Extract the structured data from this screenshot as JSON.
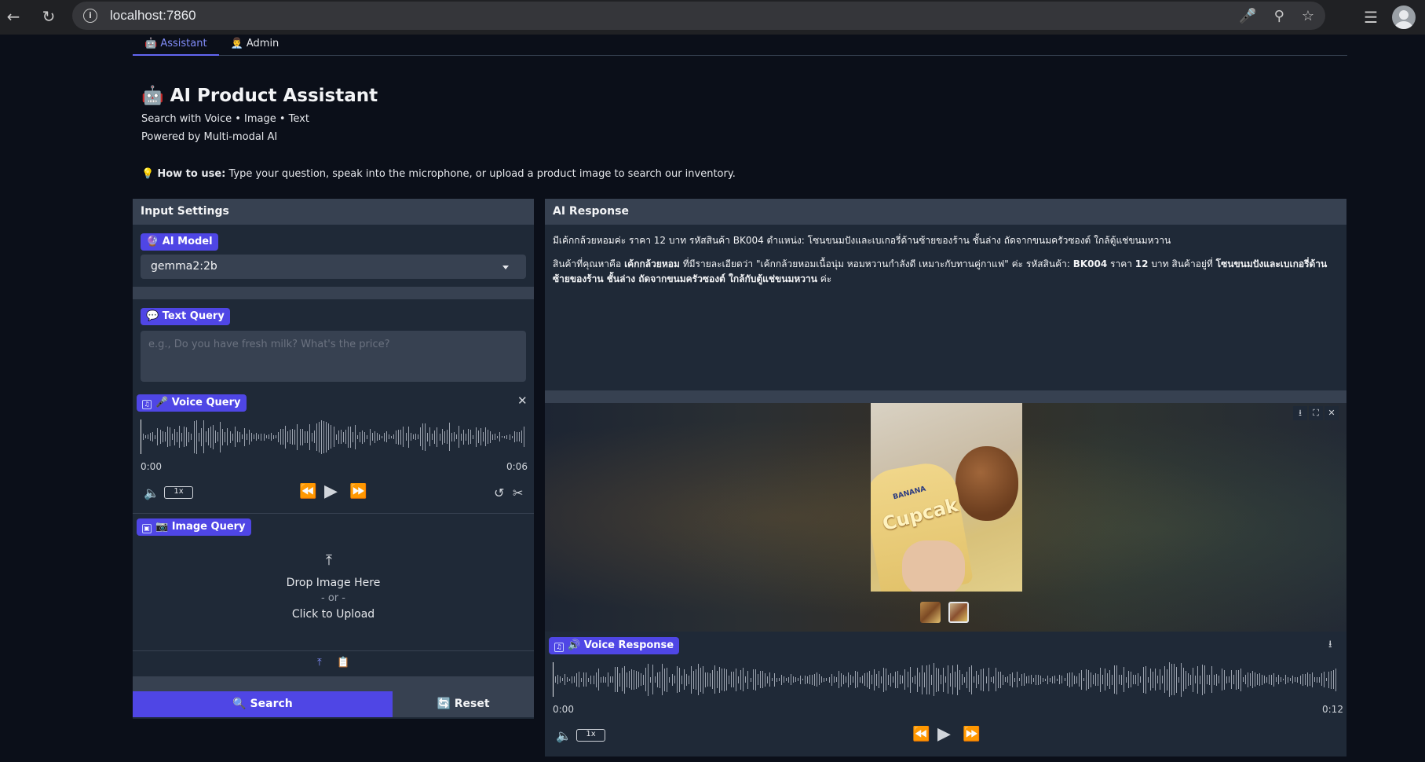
{
  "browser": {
    "url": "localhost:7860"
  },
  "tabs": [
    {
      "label": "🤖 Assistant"
    },
    {
      "label": "👨‍💼 Admin"
    }
  ],
  "header": {
    "title": "🤖 AI Product Assistant",
    "subtitle1": "Search with Voice • Image • Text",
    "subtitle2": "Powered by Multi-modal AI",
    "howto_label": "How to use:",
    "howto_text": " Type your question, speak into the microphone, or upload a product image to search our inventory."
  },
  "input_panel": {
    "title": "Input Settings",
    "model_label": "🔮 AI Model",
    "model_value": "gemma2:2b",
    "text_label": "💬 Text Query",
    "text_placeholder": "e.g., Do you have fresh milk? What's the price?",
    "voice_label": "🎤 Voice Query",
    "voice_time_start": "0:00",
    "voice_time_end": "0:06",
    "voice_speed": "1x",
    "image_label": "📷 Image Query",
    "drop_text": "Drop Image Here",
    "or_text": "- or -",
    "upload_text": "Click to Upload",
    "search_button": "🔍 Search",
    "reset_button": "🔄 Reset"
  },
  "response_panel": {
    "title": "AI Response",
    "line1": "มีเค้กกล้วยหอมค่ะ ราคา 12 บาท รหัสสินค้า BK004 ตำแหน่ง: โซนขนมปังและเบเกอรี่ด้านซ้ายของร้าน ชั้นล่าง ถัดจากขนมครัวซองต์ ใกล้ตู้แช่ขนมหวาน",
    "line2_a": "สินค้าที่คุณหาคือ ",
    "line2_b": "เค้กกล้วยหอม",
    "line2_c": " ที่มีรายละเอียดว่า \"เค้กกล้วยหอมเนื้อนุ่ม หอมหวานกำลังดี เหมาะกับทานคู่กาแฟ\" ค่ะ รหัสสินค้า: ",
    "line2_d": "BK004",
    "line2_e": " ราคา ",
    "line2_f": "12",
    "line2_g": " บาท สินค้าอยู่ที่ ",
    "line2_h": "โซนขนมปังและเบเกอรี่ด้านซ้ายของร้าน ชั้นล่าง ถัดจากขนมครัวซองต์ ใกล้กับตู้แช่ขนมหวาน",
    "line2_i": " ค่ะ",
    "product_text": "Cupcak",
    "product_brand": "BANANA",
    "voice_label": "🔊 Voice Response",
    "voice_time_start": "0:00",
    "voice_time_end": "0:12",
    "voice_speed": "1x"
  }
}
